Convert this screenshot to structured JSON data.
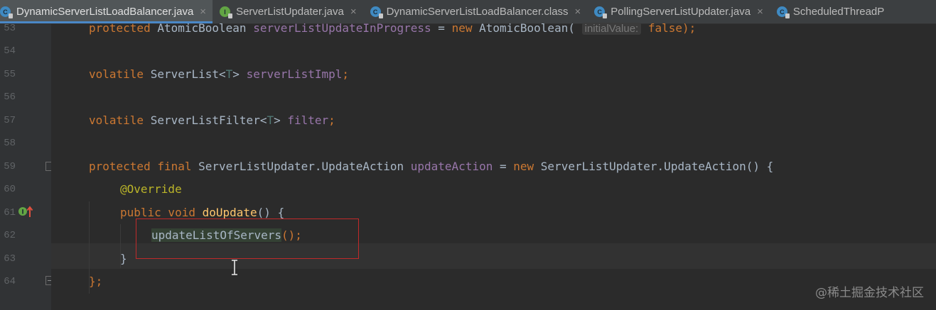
{
  "tabs": [
    {
      "label": "DynamicServerListLoadBalancer.java",
      "icon": "class-file-icon",
      "active": true,
      "close": "×"
    },
    {
      "label": "ServerListUpdater.java",
      "icon": "interface-file-icon",
      "active": false,
      "close": "×"
    },
    {
      "label": "DynamicServerListLoadBalancer.class",
      "icon": "class-file-icon",
      "active": false,
      "close": "×"
    },
    {
      "label": "PollingServerListUpdater.java",
      "icon": "class-file-icon",
      "active": false,
      "close": "×"
    },
    {
      "label": "ScheduledThreadP",
      "icon": "class-file-icon",
      "active": false,
      "close": ""
    }
  ],
  "line_numbers": [
    "53",
    "54",
    "55",
    "56",
    "57",
    "58",
    "59",
    "60",
    "61",
    "62",
    "63",
    "64"
  ],
  "code": {
    "l53": {
      "kw1": "protected",
      "type": " AtomicBoolean ",
      "field": "serverListUpdateInProgress",
      "eq": " = ",
      "kw2": "new",
      "ctor": " AtomicBoolean(",
      "hint": "initialValue:",
      "val": "false",
      "end": ");"
    },
    "l55": {
      "kw": "volatile",
      "type": " ServerList<",
      "tparam": "T",
      "close": "> ",
      "field": "serverListImpl",
      "end": ";"
    },
    "l57": {
      "kw": "volatile",
      "type": " ServerListFilter<",
      "tparam": "T",
      "close": "> ",
      "field": "filter",
      "end": ";"
    },
    "l59": {
      "kw1": "protected",
      "kw2": " final",
      "type": " ServerListUpdater.UpdateAction ",
      "field": "updateAction",
      "eq": " = ",
      "kw3": "new",
      "ctor": " ServerListUpdater.UpdateAction() {"
    },
    "l60": {
      "annotation": "@Override"
    },
    "l61": {
      "kw1": "public",
      "kw2": " void",
      "method": " doUpdate",
      "end": "() {"
    },
    "l62": {
      "call": "updateListOfServers",
      "end": "();"
    },
    "l63": {
      "brace": "}"
    },
    "l64": {
      "brace": "};"
    }
  },
  "watermark": "@稀土掘金技术社区",
  "colors": {
    "background": "#2b2b2b",
    "gutter": "#313335",
    "keyword": "#cc7832",
    "field": "#9876aa",
    "annotation": "#bbb529",
    "method": "#ffc66d",
    "highlight_box": "#c02a2a"
  }
}
